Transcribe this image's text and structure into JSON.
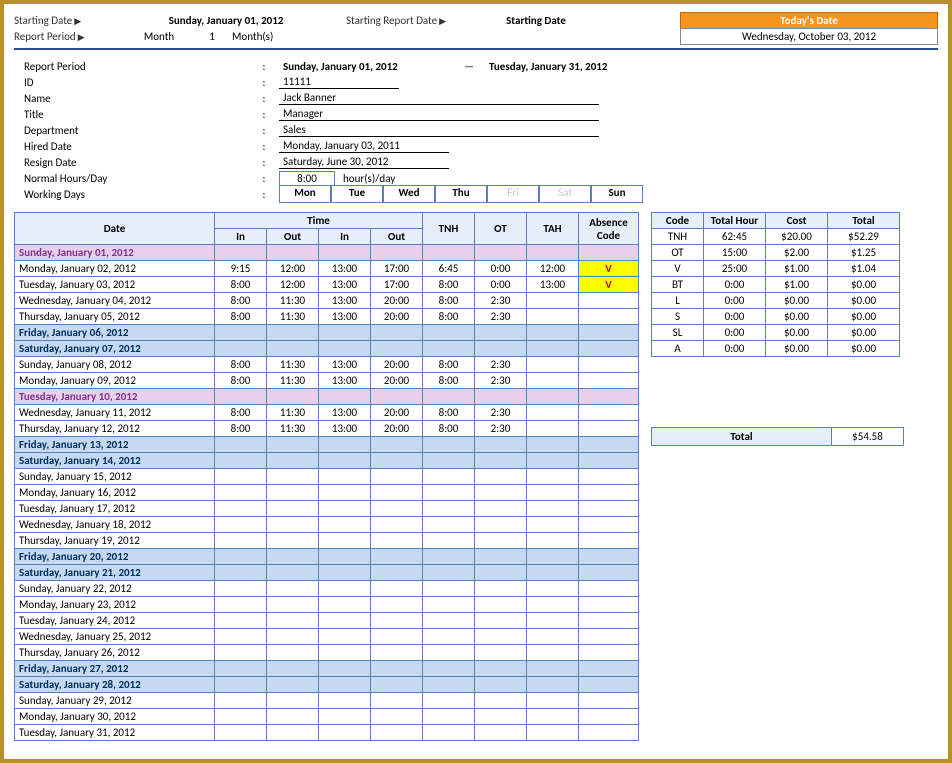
{
  "top": {
    "starting_date_label": "Starting Date",
    "starting_date_value": "Sunday, January 01, 2012",
    "starting_report_label": "Starting Report Date",
    "starting_report_value": "Starting Date",
    "today_label": "Today's Date",
    "today_value": "Wednesday, October 03, 2012",
    "report_period_label": "Report Period",
    "period_unit": "Month",
    "period_count": "1",
    "period_suffix": "Month(s)"
  },
  "info": {
    "report_period_label": "Report Period",
    "report_start": "Sunday, January 01, 2012",
    "report_end": "Tuesday, January 31, 2012",
    "id_label": "ID",
    "id_value": "11111",
    "name_label": "Name",
    "name_value": "Jack Banner",
    "title_label": "Title",
    "title_value": "Manager",
    "department_label": "Department",
    "department_value": "Sales",
    "hired_label": "Hired Date",
    "hired_value": "Monday, January 03, 2011",
    "resign_label": "Resign Date",
    "resign_value": "Saturday, June 30, 2012",
    "normal_hours_label": "Normal Hours/Day",
    "normal_hours_value": "8:00",
    "normal_hours_suffix": "hour(s)/day",
    "working_days_label": "Working Days",
    "days": [
      "Mon",
      "Tue",
      "Wed",
      "Thu",
      "Fri",
      "Sat",
      "Sun"
    ]
  },
  "headers": {
    "date": "Date",
    "time": "Time",
    "in": "In",
    "out": "Out",
    "tnh": "TNH",
    "ot": "OT",
    "tah": "TAH",
    "abs": "Absence Code"
  },
  "rows": [
    {
      "date": "Sunday, January 01, 2012",
      "cls": "sun"
    },
    {
      "date": "Monday, January 02, 2012",
      "in1": "9:15",
      "out1": "12:00",
      "in2": "13:00",
      "out2": "17:00",
      "tnh": "6:45",
      "ot": "0:00",
      "tah": "12:00",
      "abs": "V",
      "abscls": "v"
    },
    {
      "date": "Tuesday, January 03, 2012",
      "in1": "8:00",
      "out1": "12:00",
      "in2": "13:00",
      "out2": "17:00",
      "tnh": "8:00",
      "ot": "0:00",
      "tah": "13:00",
      "abs": "V",
      "abscls": "v"
    },
    {
      "date": "Wednesday, January 04, 2012",
      "in1": "8:00",
      "out1": "11:30",
      "in2": "13:00",
      "out2": "20:00",
      "tnh": "8:00",
      "ot": "2:30"
    },
    {
      "date": "Thursday, January 05, 2012",
      "in1": "8:00",
      "out1": "11:30",
      "in2": "13:00",
      "out2": "20:00",
      "tnh": "8:00",
      "ot": "2:30"
    },
    {
      "date": "Friday, January 06, 2012",
      "cls": "fri"
    },
    {
      "date": "Saturday, January 07, 2012",
      "cls": "sat"
    },
    {
      "date": "Sunday, January 08, 2012",
      "in1": "8:00",
      "out1": "11:30",
      "in2": "13:00",
      "out2": "20:00",
      "tnh": "8:00",
      "ot": "2:30"
    },
    {
      "date": "Monday, January 09, 2012",
      "in1": "8:00",
      "out1": "11:30",
      "in2": "13:00",
      "out2": "20:00",
      "tnh": "8:00",
      "ot": "2:30"
    },
    {
      "date": "Tuesday, January 10, 2012",
      "cls": "tue10"
    },
    {
      "date": "Wednesday, January 11, 2012",
      "in1": "8:00",
      "out1": "11:30",
      "in2": "13:00",
      "out2": "20:00",
      "tnh": "8:00",
      "ot": "2:30"
    },
    {
      "date": "Thursday, January 12, 2012",
      "in1": "8:00",
      "out1": "11:30",
      "in2": "13:00",
      "out2": "20:00",
      "tnh": "8:00",
      "ot": "2:30"
    },
    {
      "date": "Friday, January 13, 2012",
      "cls": "fri"
    },
    {
      "date": "Saturday, January 14, 2012",
      "cls": "sat"
    },
    {
      "date": "Sunday, January 15, 2012"
    },
    {
      "date": "Monday, January 16, 2012"
    },
    {
      "date": "Tuesday, January 17, 2012"
    },
    {
      "date": "Wednesday, January 18, 2012"
    },
    {
      "date": "Thursday, January 19, 2012"
    },
    {
      "date": "Friday, January 20, 2012",
      "cls": "fri"
    },
    {
      "date": "Saturday, January 21, 2012",
      "cls": "sat"
    },
    {
      "date": "Sunday, January 22, 2012"
    },
    {
      "date": "Monday, January 23, 2012"
    },
    {
      "date": "Tuesday, January 24, 2012"
    },
    {
      "date": "Wednesday, January 25, 2012"
    },
    {
      "date": "Thursday, January 26, 2012"
    },
    {
      "date": "Friday, January 27, 2012",
      "cls": "fri"
    },
    {
      "date": "Saturday, January 28, 2012",
      "cls": "sat"
    },
    {
      "date": "Sunday, January 29, 2012"
    },
    {
      "date": "Monday, January 30, 2012"
    },
    {
      "date": "Tuesday, January 31, 2012"
    }
  ],
  "summary": {
    "headers": {
      "code": "Code",
      "th": "Total Hour",
      "cost": "Cost",
      "total": "Total"
    },
    "rows": [
      {
        "code": "TNH",
        "th": "62:45",
        "cost": "$20.00",
        "total": "$52.29"
      },
      {
        "code": "OT",
        "th": "15:00",
        "cost": "$2.00",
        "total": "$1.25"
      },
      {
        "code": "V",
        "th": "25:00",
        "cost": "$1.00",
        "total": "$1.04"
      },
      {
        "code": "BT",
        "th": "0:00",
        "cost": "$1.00",
        "total": "$0.00"
      },
      {
        "code": "L",
        "th": "0:00",
        "cost": "$0.00",
        "total": "$0.00"
      },
      {
        "code": "S",
        "th": "0:00",
        "cost": "$0.00",
        "total": "$0.00"
      },
      {
        "code": "SL",
        "th": "0:00",
        "cost": "$0.00",
        "total": "$0.00"
      },
      {
        "code": "A",
        "th": "0:00",
        "cost": "$0.00",
        "total": "$0.00"
      }
    ],
    "grand_label": "Total",
    "grand_value": "$54.58"
  }
}
